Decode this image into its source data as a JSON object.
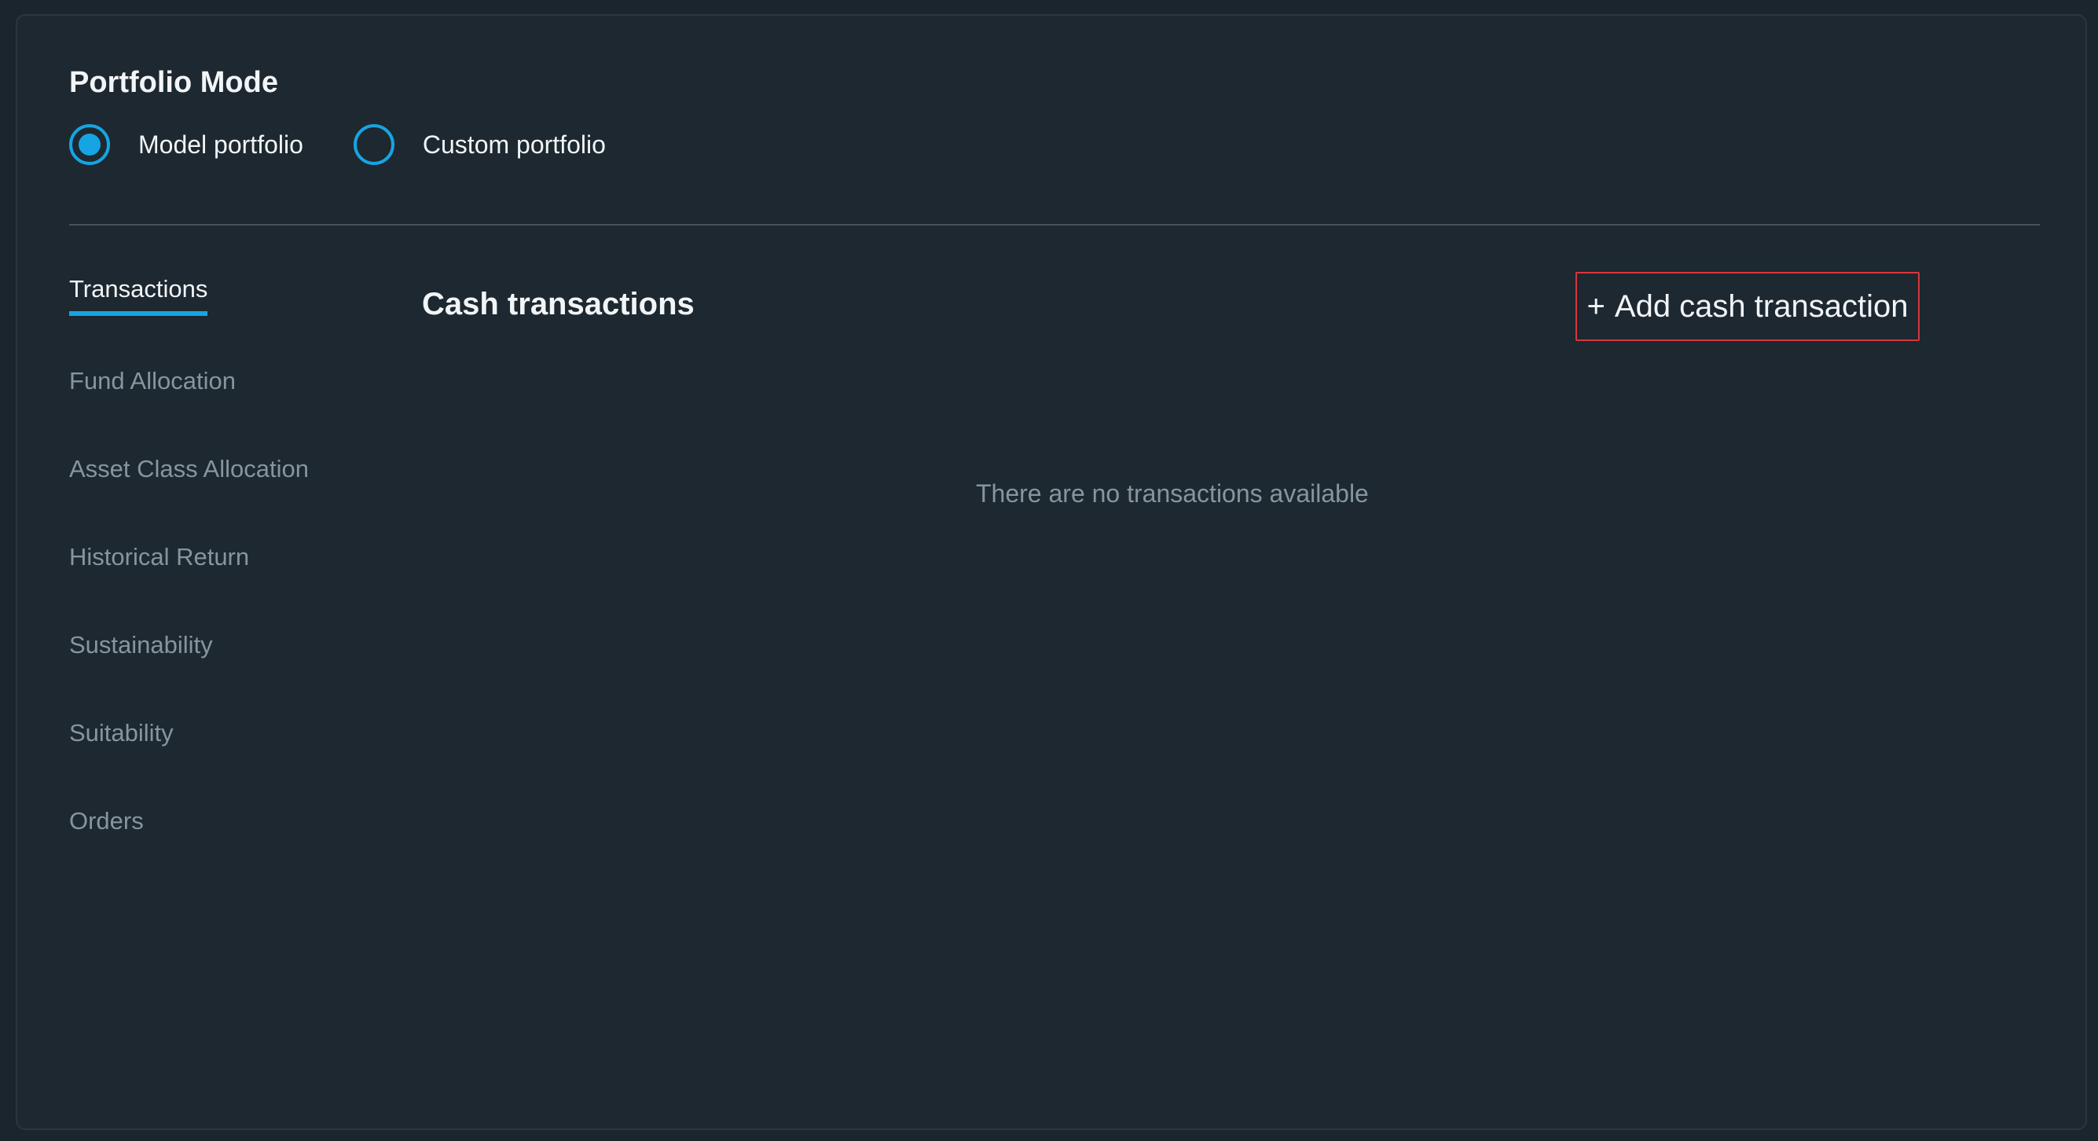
{
  "portfolio_mode": {
    "title": "Portfolio Mode",
    "options": [
      {
        "label": "Model portfolio",
        "selected": true
      },
      {
        "label": "Custom portfolio",
        "selected": false
      }
    ]
  },
  "nav": {
    "items": [
      {
        "label": "Transactions",
        "active": true
      },
      {
        "label": "Fund Allocation",
        "active": false
      },
      {
        "label": "Asset Class Allocation",
        "active": false
      },
      {
        "label": "Historical Return",
        "active": false
      },
      {
        "label": "Sustainability",
        "active": false
      },
      {
        "label": "Suitability",
        "active": false
      },
      {
        "label": "Orders",
        "active": false
      }
    ]
  },
  "cash_transactions": {
    "title": "Cash transactions",
    "add_button": {
      "icon": "plus-icon",
      "icon_glyph": "+",
      "label": "Add cash transaction"
    },
    "empty_message": "There are no transactions available"
  },
  "colors": {
    "background": "#1b252d",
    "panel": "#1d2830",
    "accent": "#16a4e2",
    "text_primary": "#f2f5f7",
    "text_muted": "#86959f",
    "highlight_border": "#d8363e"
  }
}
